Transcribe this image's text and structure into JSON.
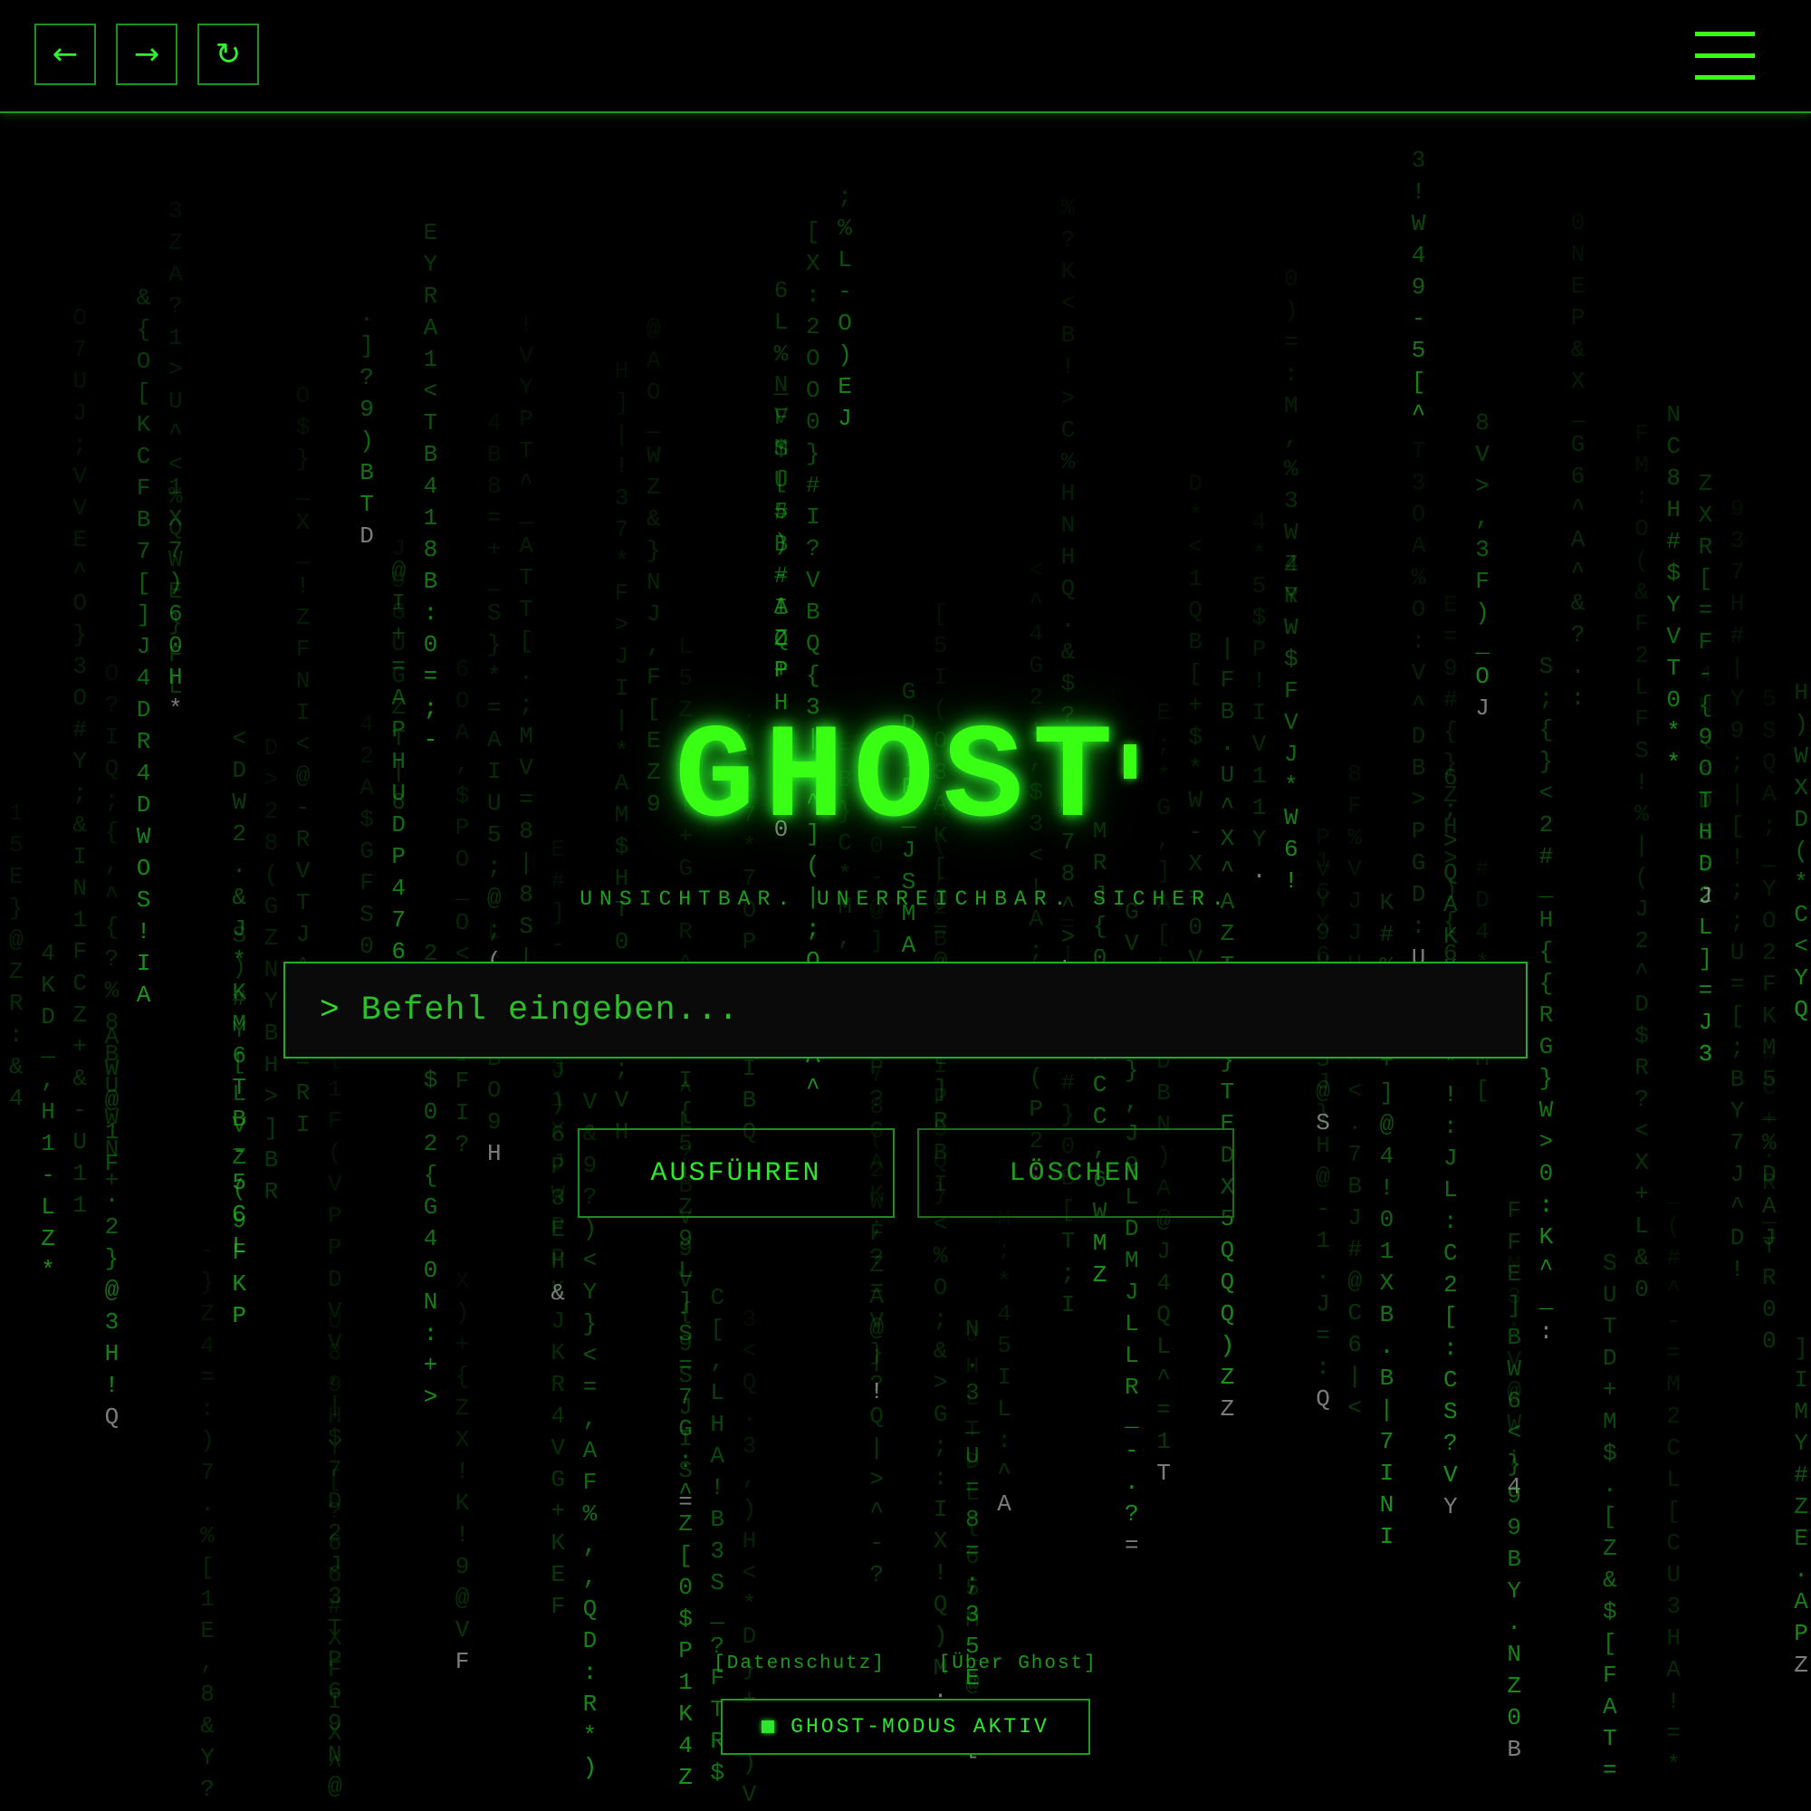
{
  "nav": {
    "back_icon": "←",
    "forward_icon": "→",
    "reload_icon": "↻",
    "menu_icon": "hamburger-menu-icon"
  },
  "hero": {
    "title": "GHOST",
    "tagline": "UNSICHTBAR. UNERREICHBAR. SICHER."
  },
  "command": {
    "prompt": ">",
    "placeholder": "Befehl eingeben...",
    "value": ""
  },
  "actions": {
    "run_label": "AUSFÜHREN",
    "clear_label": "LÖSCHEN"
  },
  "footer": {
    "links": [
      "[Datenschutz]",
      "[Über Ghost]"
    ],
    "status": "GHOST-MODUS AKTIV"
  },
  "colors": {
    "accent": "#39ff14",
    "border": "#1f9a1f",
    "background": "#000000"
  }
}
